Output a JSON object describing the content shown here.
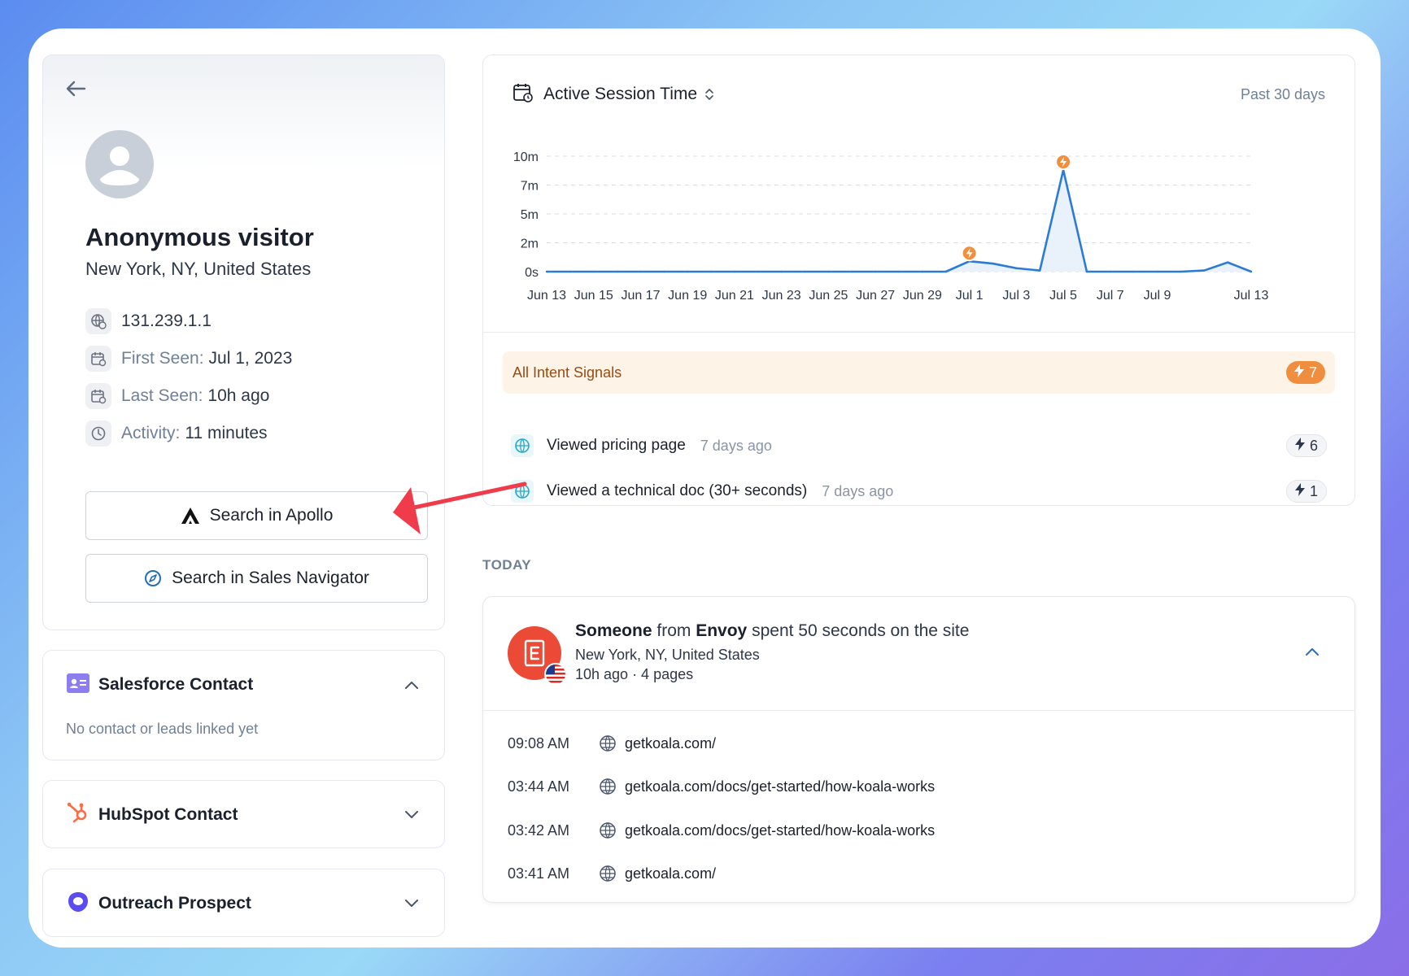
{
  "profile": {
    "name": "Anonymous visitor",
    "location": "New York, NY, United States",
    "ip": "131.239.1.1",
    "first_seen_label": "First Seen:",
    "first_seen_value": "Jul 1, 2023",
    "last_seen_label": "Last Seen:",
    "last_seen_value": "10h ago",
    "activity_label": "Activity:",
    "activity_value": "11 minutes",
    "apollo_button": "Search in Apollo",
    "navigator_button": "Search in Sales Navigator"
  },
  "integrations": {
    "salesforce": {
      "title": "Salesforce Contact",
      "empty": "No contact or leads linked yet",
      "expanded": true
    },
    "hubspot": {
      "title": "HubSpot Contact",
      "expanded": false
    },
    "outreach": {
      "title": "Outreach Prospect",
      "expanded": false
    }
  },
  "chart_header": {
    "title": "Active Session Time",
    "range": "Past 30 days"
  },
  "chart_data": {
    "type": "line",
    "y_tick_labels": [
      "10m",
      "7m",
      "5m",
      "2m",
      "0s"
    ],
    "x_tick_labels": [
      "Jun 13",
      "Jun 15",
      "Jun 17",
      "Jun 19",
      "Jun 21",
      "Jun 23",
      "Jun 25",
      "Jun 27",
      "Jun 29",
      "Jul 1",
      "Jul 3",
      "Jul 5",
      "Jul 7",
      "Jul 9",
      "Jul 13"
    ],
    "x": [
      "Jun 13",
      "Jun 14",
      "Jun 15",
      "Jun 16",
      "Jun 17",
      "Jun 18",
      "Jun 19",
      "Jun 20",
      "Jun 21",
      "Jun 22",
      "Jun 23",
      "Jun 24",
      "Jun 25",
      "Jun 26",
      "Jun 27",
      "Jun 28",
      "Jun 29",
      "Jun 30",
      "Jul 1",
      "Jul 2",
      "Jul 3",
      "Jul 4",
      "Jul 5",
      "Jul 6",
      "Jul 7",
      "Jul 8",
      "Jul 9",
      "Jul 10",
      "Jul 11",
      "Jul 12",
      "Jul 13"
    ],
    "values": [
      0,
      0,
      0,
      0,
      0,
      0,
      0,
      0,
      0,
      0,
      0,
      0,
      0,
      0,
      0,
      0,
      0,
      0,
      0.9,
      0.7,
      0.3,
      0.1,
      8.8,
      0,
      0,
      0,
      0,
      0,
      0.1,
      0.8,
      0
    ],
    "ylim": [
      0,
      10
    ],
    "signal_markers": [
      "Jul 1",
      "Jul 5"
    ],
    "grid": true,
    "colors": {
      "line": "#2b7bd6",
      "fill": "#e9f1fb",
      "marker": "#f0903f"
    }
  },
  "signals": {
    "title": "All Intent Signals",
    "total": "7",
    "items": [
      {
        "text": "Viewed pricing page",
        "time": "7 days ago",
        "count": "6"
      },
      {
        "text": "Viewed a technical doc (30+ seconds)",
        "time": "7 days ago",
        "count": "1"
      }
    ]
  },
  "today_label": "TODAY",
  "session": {
    "who": "Someone",
    "from": "from",
    "company": "Envoy",
    "rest": "spent 50 seconds on the site",
    "location": "New York, NY, United States",
    "meta": "10h ago · 4 pages",
    "visits": [
      {
        "time": "09:08 AM",
        "url": "getkoala.com/"
      },
      {
        "time": "03:44 AM",
        "url": "getkoala.com/docs/get-started/how-koala-works"
      },
      {
        "time": "03:42 AM",
        "url": "getkoala.com/docs/get-started/how-koala-works"
      },
      {
        "time": "03:41 AM",
        "url": "getkoala.com/"
      }
    ]
  }
}
